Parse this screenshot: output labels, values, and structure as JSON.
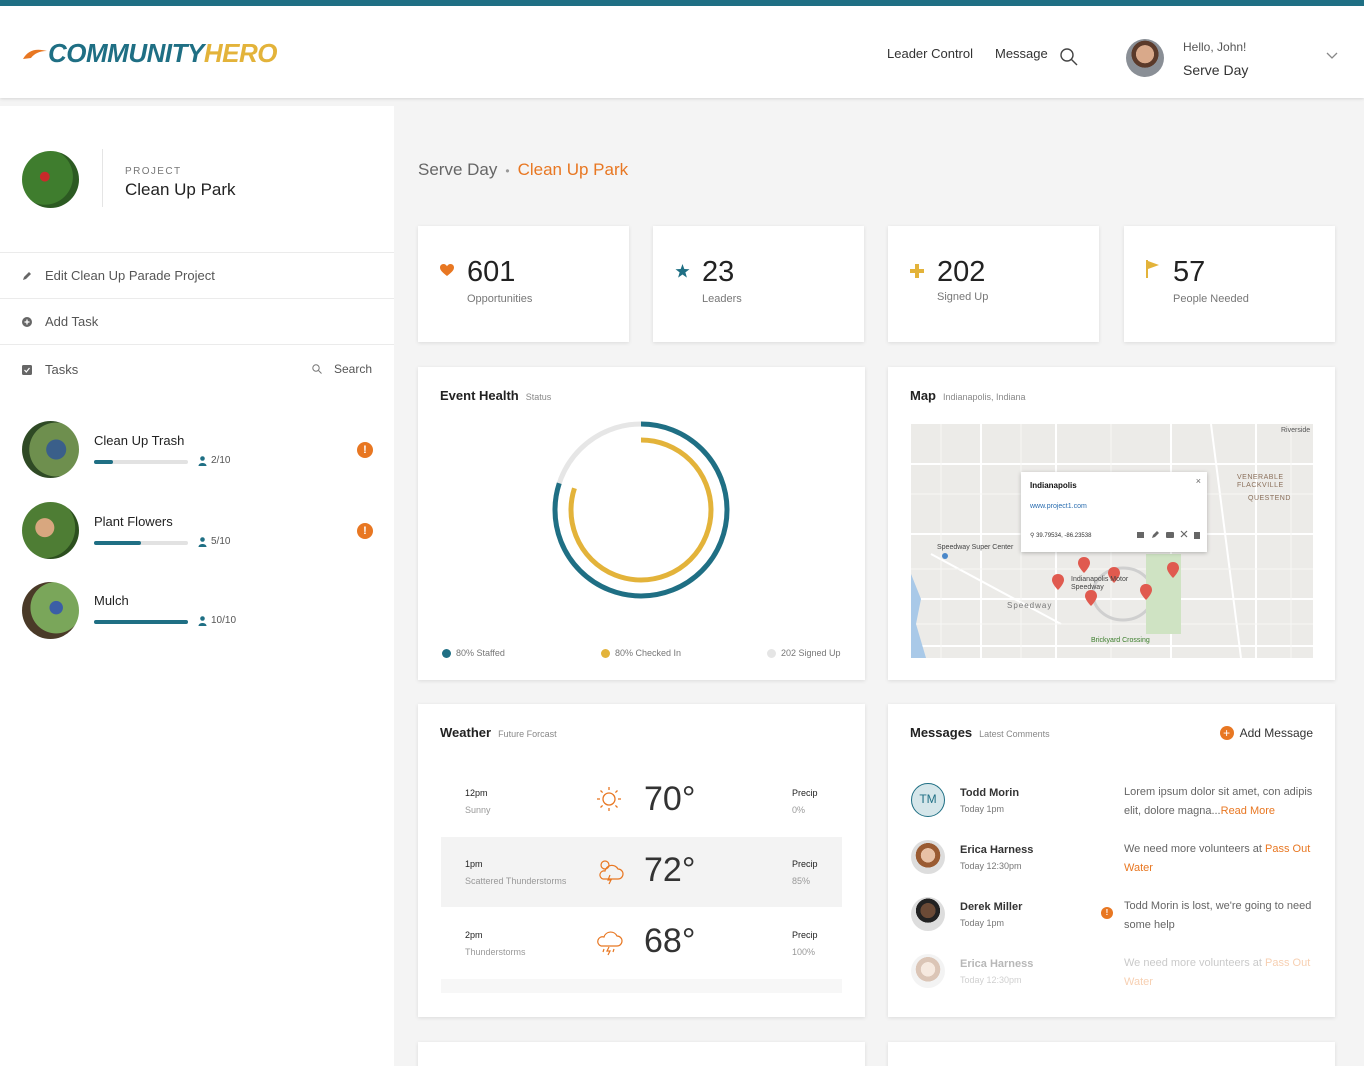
{
  "header": {
    "logo_community": "COMMUNITY",
    "logo_hero": "HERO",
    "nav": [
      "Leader Control",
      "Message"
    ],
    "greeting": "Hello, John!",
    "user_context": "Serve Day"
  },
  "sidebar": {
    "project_kicker": "PROJECT",
    "project_name": "Clean Up Park",
    "edit_label": "Edit Clean Up Parade Project",
    "add_task_label": "Add Task",
    "tasks_label": "Tasks",
    "search_label": "Search",
    "tasks": [
      {
        "name": "Clean Up Trash",
        "count": "2/10",
        "progress": 0.2,
        "alert": "!"
      },
      {
        "name": "Plant Flowers",
        "count": "5/10",
        "progress": 0.5,
        "alert": "!"
      },
      {
        "name": "Mulch",
        "count": "10/10",
        "progress": 1.0
      }
    ]
  },
  "breadcrumb": {
    "parent": "Serve Day",
    "separator": "•",
    "current": "Clean Up Park"
  },
  "stats": [
    {
      "value": "601",
      "label": "Opportunities",
      "icon": "heart-icon",
      "color": "#e87722"
    },
    {
      "value": "23",
      "label": "Leaders",
      "icon": "star-icon",
      "color": "#1f6f84"
    },
    {
      "value": "202",
      "label": "Signed Up",
      "icon": "plus-icon",
      "color": "#e3b33a"
    },
    {
      "value": "57",
      "label": "People Needed",
      "icon": "flag-icon",
      "color": "#e3b33a"
    }
  ],
  "event_health": {
    "title": "Event Health",
    "subtitle": "Status",
    "legend": [
      {
        "label": "80% Staffed",
        "color": "#1f6f84",
        "value": 0.8
      },
      {
        "label": "80% Checked In",
        "color": "#e3b33a",
        "value": 0.8
      },
      {
        "label": "202 Signed Up",
        "color": "#e5e5e5"
      }
    ]
  },
  "map": {
    "title": "Map",
    "subtitle": "Indianapolis, Indiana",
    "popup_title": "Indianapolis",
    "popup_url": "www.project1.com",
    "popup_coords": "39.79534, -86.23538",
    "labels": [
      "Speedway Super Center",
      "Indianapolis Motor Speedway",
      "Speedway",
      "VENERABLE FLACKVILLE",
      "QUESTEND",
      "Riverside",
      "Brickyard Crossing"
    ]
  },
  "weather": {
    "title": "Weather",
    "subtitle": "Future Forcast",
    "rows": [
      {
        "time": "12pm",
        "desc": "Sunny",
        "temp": "70°",
        "precip_label": "Precip",
        "precip": "0%",
        "icon": "sun-icon"
      },
      {
        "time": "1pm",
        "desc": "Scattered Thunderstorms",
        "temp": "72°",
        "precip_label": "Precip",
        "precip": "85%",
        "icon": "thunderstorm-icon"
      },
      {
        "time": "2pm",
        "desc": "Thunderstorms",
        "temp": "68°",
        "precip_label": "Precip",
        "precip": "100%",
        "icon": "storm-cloud-icon"
      }
    ]
  },
  "messages": {
    "title": "Messages",
    "subtitle": "Latest Comments",
    "add_label": "Add Message",
    "items": [
      {
        "name": "Todd Morin",
        "time": "Today 1pm",
        "text": "Lorem ipsum dolor sit amet, con adipis elit,  dolore magna...",
        "link": "Read More",
        "initials": "TM"
      },
      {
        "name": "Erica Harness",
        "time": "Today 12:30pm",
        "text": "We need more volunteers at ",
        "link": "Pass Out Water"
      },
      {
        "name": "Derek Miller",
        "time": "Today 1pm",
        "text": "Todd Morin is lost, we're going to need some help",
        "alert": "!"
      },
      {
        "name": "Erica Harness",
        "time": "Today 12:30pm",
        "text": "We need more volunteers at ",
        "link": "Pass Out Water"
      }
    ]
  }
}
